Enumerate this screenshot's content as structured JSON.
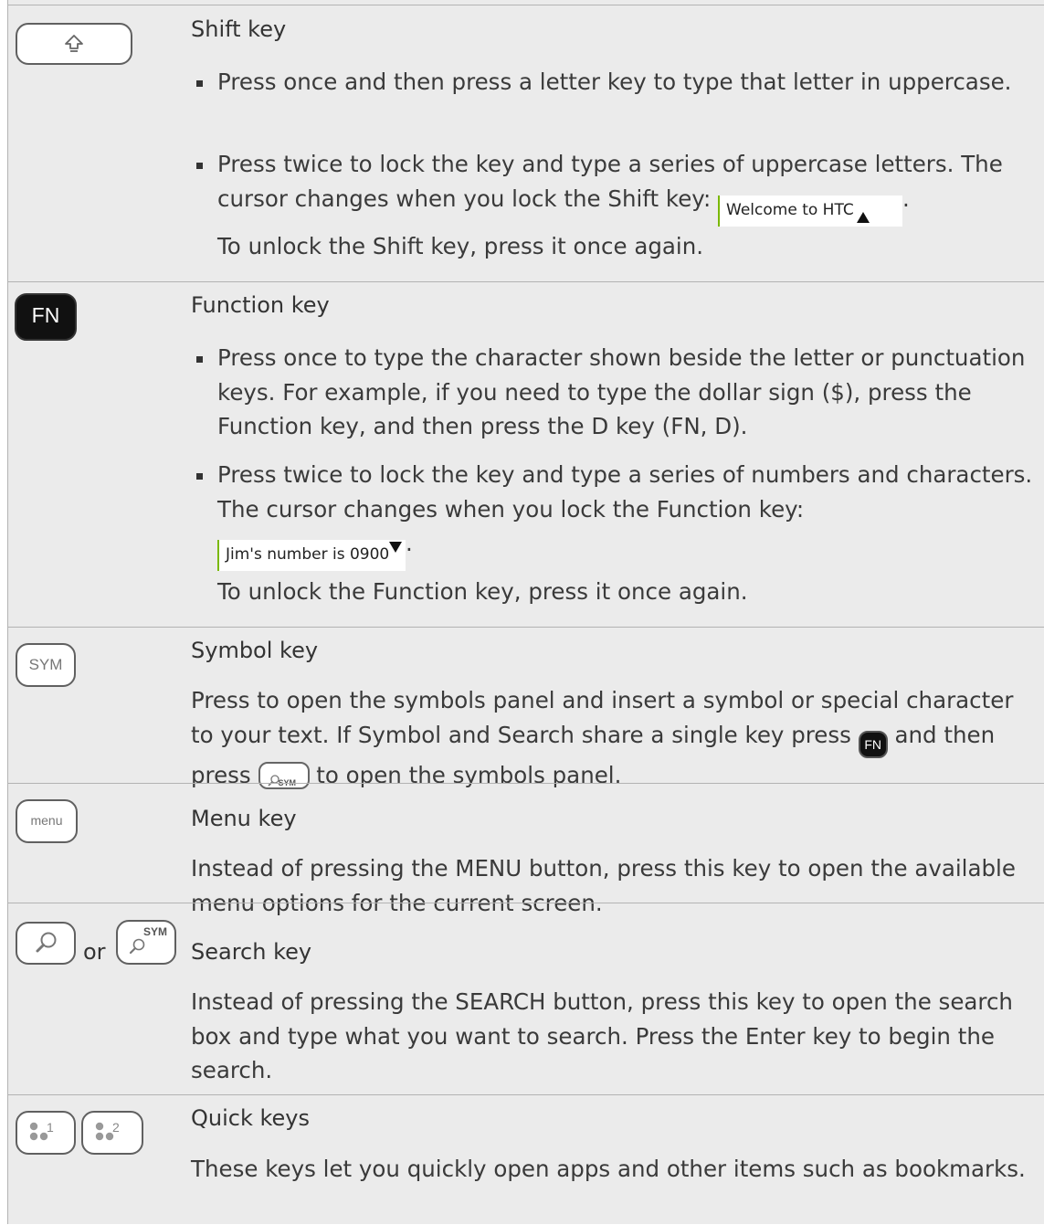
{
  "rows": [
    {
      "title": "Shift key",
      "bullets": [
        "Press once and then press a letter key to type that letter in uppercase.",
        "Press twice to lock the key and type a series of uppercase letters. The cursor changes when you lock the Shift key:"
      ],
      "field": "Welcome to HTC",
      "tail": "To unlock the Shift key, press it once again.",
      "key_icon": "shift-arrow-icon"
    },
    {
      "title": "Function key",
      "bullets": [
        "Press once to type the character shown beside the letter or punctuation keys. For example, if you need to type the dollar sign ($), press the Function key, and then press the D key (FN, D).",
        "Press twice to lock the key and type a series of numbers and characters. The cursor changes when you lock the Function key:"
      ],
      "field": "Jim's number is 0900",
      "tail": "To unlock the Function key, press it once again.",
      "key_label": "FN"
    },
    {
      "title": "Symbol key",
      "body_a": "Press to open the symbols panel and insert a symbol or special character to your text. If Symbol and Search share a single key press",
      "body_b": "and then press",
      "body_c": "to open the symbols panel.",
      "key_label": "SYM",
      "inline_fn_label": "FN",
      "inline_sym_label": "SYM"
    },
    {
      "title": "Menu key",
      "body": "Instead of pressing the MENU button, press this key to open the available menu options for the current screen.",
      "key_label": "menu"
    },
    {
      "title": "Search key",
      "body": "Instead of pressing the SEARCH button, press this key to open the search box and type what you want to search. Press the Enter key to begin the search.",
      "or_label": "or",
      "sym_label": "SYM"
    },
    {
      "title": "Quick keys",
      "body": "These keys let you quickly open apps and other items such as bookmarks.",
      "quick_key_1": "1",
      "quick_key_2": "2"
    }
  ],
  "colors": {
    "row_bg": "#ebebeb",
    "rule": "#b3b3b3",
    "field_accent": "#7ab800",
    "text": "#3a3a3a"
  }
}
